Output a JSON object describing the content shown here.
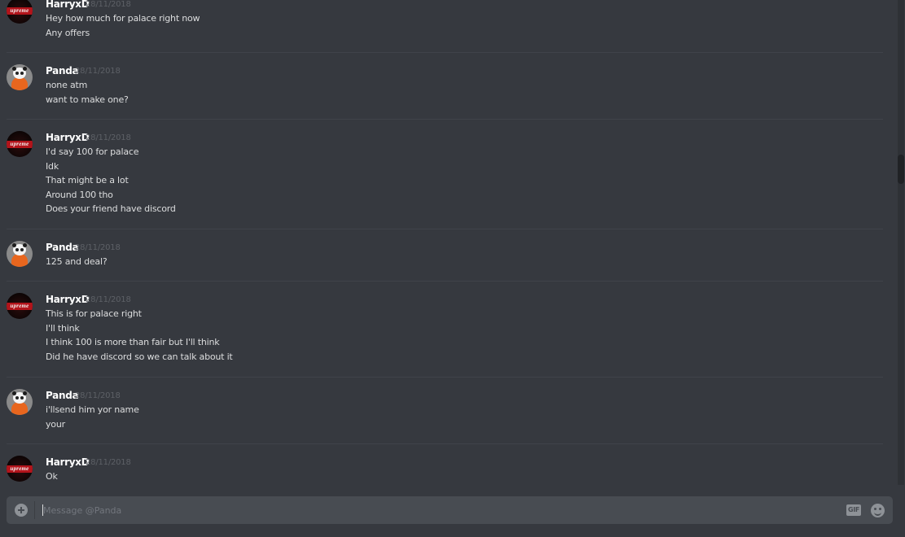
{
  "messages": [
    {
      "author": "HarryxD",
      "avatar": "supreme",
      "timestamp": "28/11/2018",
      "lines": [
        "Hey how much for palace right now",
        "Any offers"
      ]
    },
    {
      "author": "Panda",
      "avatar": "panda",
      "timestamp": "28/11/2018",
      "lines": [
        "none atm",
        "want to make one?"
      ]
    },
    {
      "author": "HarryxD",
      "avatar": "supreme",
      "timestamp": "28/11/2018",
      "lines": [
        "I'd say 100 for palace",
        "Idk",
        "That might be a lot",
        "Around 100 tho",
        "Does your friend have discord"
      ]
    },
    {
      "author": "Panda",
      "avatar": "panda",
      "timestamp": "28/11/2018",
      "lines": [
        "125 and deal?"
      ]
    },
    {
      "author": "HarryxD",
      "avatar": "supreme",
      "timestamp": "28/11/2018",
      "lines": [
        "This is for palace right",
        "I'll think",
        "I think 100 is more than fair but I'll think",
        "Did he have discord so we can talk about it"
      ]
    },
    {
      "author": "Panda",
      "avatar": "panda",
      "timestamp": "28/11/2018",
      "lines": [
        "i'llsend him yor name",
        "your"
      ]
    },
    {
      "author": "HarryxD",
      "avatar": "supreme",
      "timestamp": "28/11/2018",
      "lines": [
        "Ok"
      ]
    }
  ],
  "avatar_text": {
    "supreme": "upreme"
  },
  "composer": {
    "placeholder": "Message @Panda",
    "value": "",
    "gif_label": "GIF"
  },
  "icons": {
    "upload": "plus-circle-icon",
    "gif": "gif-icon",
    "emoji": "emoji-smile-icon"
  },
  "colors": {
    "background": "#36393f",
    "composer": "#484c52",
    "username": "#ffffff",
    "message_text": "#dcddde",
    "timestamp": "#5d6066"
  }
}
